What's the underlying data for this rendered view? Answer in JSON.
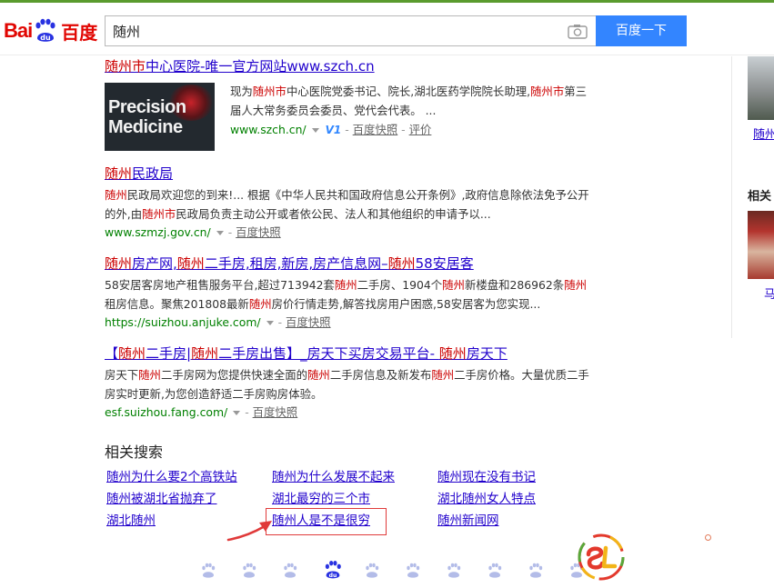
{
  "header": {
    "logo_bai": "Bai",
    "logo_du": "du",
    "logo_cn": "百度",
    "search_value": "随州",
    "search_button": "百度一下"
  },
  "results": [
    {
      "title_parts": [
        "随州市",
        "中心医院-唯一官方网站www.szch.cn"
      ],
      "thumb_line1": "Precision",
      "thumb_line2": "Medicine",
      "abs_html": "现为<em>随州市</em>中心医院党委书记、院长,湖北医药学院院长助理,<em>随州市</em>第三届人大常务委员会委员、党代会代表。 ...",
      "url": "www.szch.cn/",
      "v_badge": "V1",
      "snapshot": "百度快照",
      "extra": "评价"
    },
    {
      "title_parts": [
        "随州",
        "民政局"
      ],
      "abs_html": "<em>随州</em>民政局欢迎您的到来!... 根据《中华人民共和国政府信息公开条例》,政府信息除依法免予公开的外,由<em>随州市</em>民政局负责主动公开或者依公民、法人和其他组织的申请予以...",
      "url": "www.szmzj.gov.cn/",
      "snapshot": "百度快照"
    },
    {
      "title_html": "<em>随州</em>房产网,<em>随州</em>二手房,租房,新房,房产信息网–<em>随州</em>58安居客",
      "abs_html": "58安居客房地产租售服务平台,超过713942套<em>随州</em>二手房、1904个<em>随州</em>新楼盘和286962条<em>随州</em>租房信息。聚焦201808最新<em>随州</em>房价行情走势,解答找房用户困惑,58安居客为您实现...",
      "url": "https://suizhou.anjuke.com/",
      "snapshot": "百度快照"
    },
    {
      "title_html": "【<em>随州</em>二手房|<em>随州</em>二手房出售】_房天下买房交易平台- <em>随州</em>房天下",
      "abs_html": "房天下<em>随州</em>二手房网为您提供快速全面的<em>随州</em>二手房信息及新发布<em>随州</em>二手房价格。大量优质二手房实时更新,为您创造舒适二手房购房体验。",
      "url": "esf.suizhou.fang.com/",
      "snapshot": "百度快照"
    }
  ],
  "related": {
    "heading": "相关搜索",
    "links": [
      "随州为什么要2个高铁站",
      "随州为什么发展不起来",
      "随州现在没有书记",
      "随州被湖北省抛弃了",
      "湖北最穷的三个市",
      "湖北随州女人特点",
      "湖北随州",
      "随州人是不是很穷",
      "随州新闻网"
    ]
  },
  "sidebar": {
    "link1": "随州",
    "heading": "相关",
    "link2": "马"
  },
  "colors": {
    "link": "#2000cc",
    "highlight": "#cc0000",
    "url_green": "#008000",
    "button_blue": "#3385ff",
    "annotation_red": "#e03a3a"
  },
  "pager": {
    "current_page_icon": "du"
  }
}
